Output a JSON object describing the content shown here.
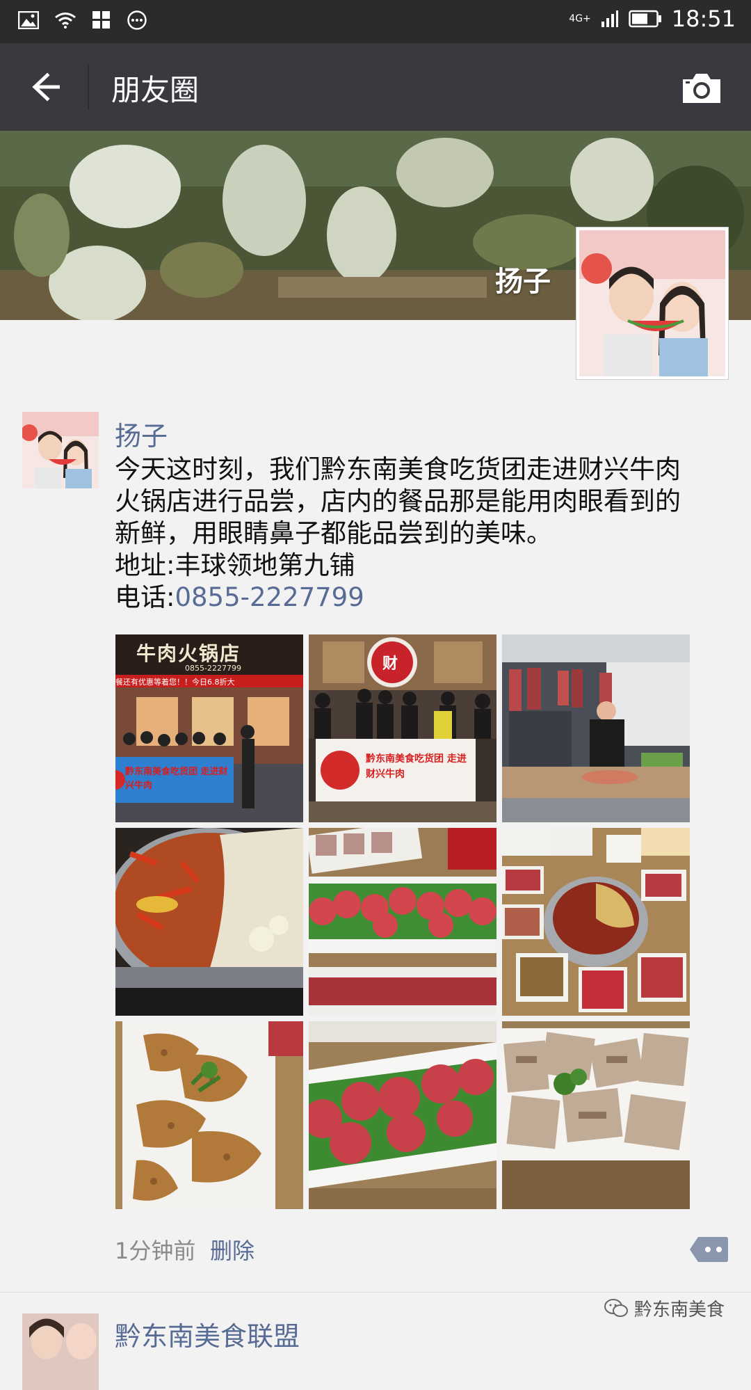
{
  "status_bar": {
    "network": "4G+",
    "time": "18:51"
  },
  "nav": {
    "title": "朋友圈"
  },
  "cover": {
    "user_name": "扬子"
  },
  "post": {
    "author": "扬子",
    "lines": [
      "今天这时刻，我们黔东南美食吃货团走进财兴牛肉",
      "火锅店进行品尝，店内的餐品那是能用肉眼看到的",
      "新鲜，用眼睛鼻子都能品尝到的美味。",
      "地址:丰球领地第九铺"
    ],
    "phone_prefix": "电话:",
    "phone": "0855-2227799",
    "photos": [
      {
        "name": "photo-storefront",
        "sign": "牛肉火锅店",
        "sub": "0855-2227799",
        "banner": "餐还有优惠等着您！！今日6.8折大",
        "flag": "黔东南美食吃货团 走进财兴牛肉"
      },
      {
        "name": "photo-group-banner",
        "logo": "财",
        "flag": "黔东南美食吃货团 走进财兴牛肉"
      },
      {
        "name": "photo-butcher"
      },
      {
        "name": "photo-hotpot"
      },
      {
        "name": "photo-meatballs-plate"
      },
      {
        "name": "photo-table-spread"
      },
      {
        "name": "photo-tripe"
      },
      {
        "name": "photo-meatballs-closeup"
      },
      {
        "name": "photo-sliced-beef"
      }
    ],
    "time_ago": "1分钟前",
    "delete_label": "删除"
  },
  "next_post": {
    "author": "黔东南美食联盟"
  },
  "watermark": {
    "text": "黔东南美食"
  },
  "colors": {
    "status_bar": "#2b2b2b",
    "nav_bar": "#393a3f",
    "link": "#576b95",
    "background": "#f2f2f2"
  }
}
